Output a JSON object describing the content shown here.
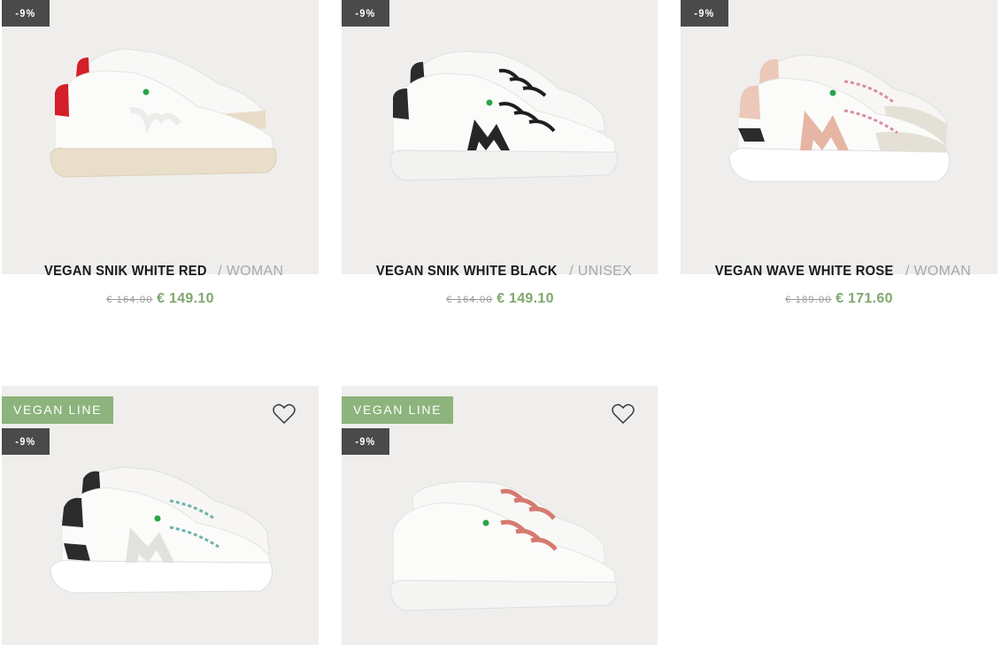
{
  "colors": {
    "tile_bg": "#efeeec",
    "badge_bg": "#4a4a4a",
    "vegan_bg": "#8cb47c",
    "sale_price": "#7fa86e",
    "old_price": "#9a9a9a"
  },
  "products": [
    {
      "discount": "-9%",
      "name": "VEGAN SNIK WHITE RED",
      "separator": "/",
      "gender": "WOMAN",
      "old_price": "€ 164.00",
      "price": "€ 149.10",
      "image": "white-sneaker-red-heel"
    },
    {
      "discount": "-9%",
      "name": "VEGAN SNIK WHITE BLACK",
      "separator": "/",
      "gender": "UNISEX",
      "old_price": "€ 164.00",
      "price": "€ 149.10",
      "image": "white-sneaker-black-laces"
    },
    {
      "discount": "-9%",
      "name": "VEGAN WAVE WHITE ROSE",
      "separator": "/",
      "gender": "WOMAN",
      "old_price": "€ 189.00",
      "price": "€ 171.60",
      "image": "white-runner-rose"
    },
    {
      "tag": "VEGAN LINE",
      "discount": "-9%",
      "image": "white-runner-black-heel",
      "wishlist_icon": "heart-icon"
    },
    {
      "tag": "VEGAN LINE",
      "discount": "-9%",
      "image": "white-sneaker-pink-laces",
      "wishlist_icon": "heart-icon"
    }
  ]
}
